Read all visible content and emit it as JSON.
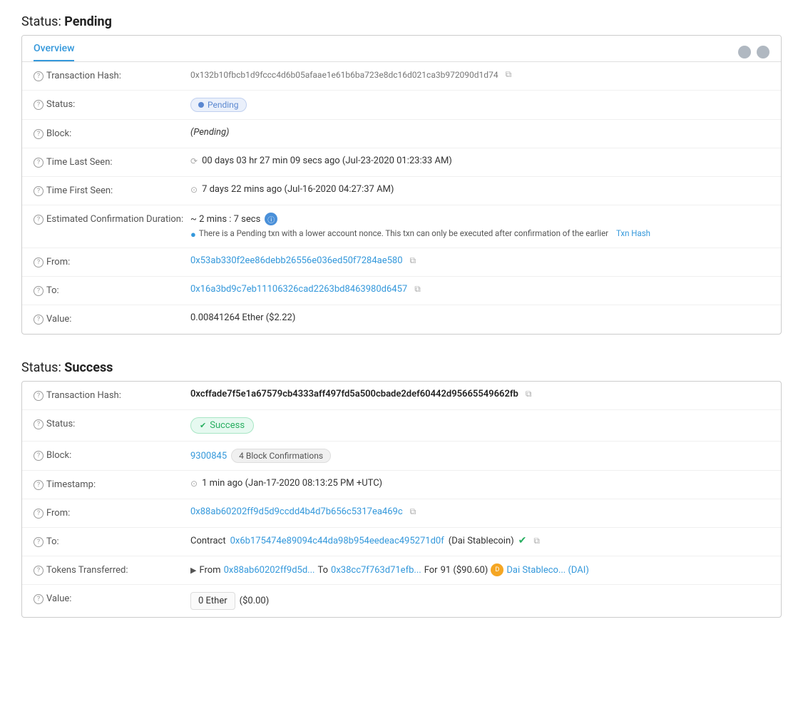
{
  "pending": {
    "section_title": "Status: ",
    "section_title_bold": "Pending",
    "tab_label": "Overview",
    "tx_hash_label": "Transaction Hash:",
    "tx_hash_value": "0x132b10fbcb1d9fccc4d6b05afaae1e61b6ba723e8dc16d021ca3b972090d1d74",
    "status_label": "Status:",
    "status_value": "Pending",
    "block_label": "Block:",
    "block_value": "(Pending)",
    "time_last_seen_label": "Time Last Seen:",
    "time_last_seen_value": "00 days 03 hr 27 min 09 secs ago (Jul-23-2020 01:23:33 AM)",
    "time_first_seen_label": "Time First Seen:",
    "time_first_seen_value": "7 days 22 mins ago (Jul-16-2020 04:27:37 AM)",
    "est_confirmation_label": "Estimated Confirmation Duration:",
    "est_confirmation_value": "~ 2 mins : 7 secs",
    "warning_text": "There is a Pending txn with a lower account nonce. This txn can only be executed after confirmation of the earlier",
    "warning_link": "Txn Hash",
    "from_label": "From:",
    "from_value": "0x53ab330f2ee86debb26556e036ed50f7284ae580",
    "to_label": "To:",
    "to_value": "0x16a3bd9c7eb11106326cad2263bd8463980d6457",
    "value_label": "Value:",
    "value_eth": "0.00841264 Ether ($2.22)"
  },
  "success": {
    "section_title": "Status: ",
    "section_title_bold": "Success",
    "tx_hash_label": "Transaction Hash:",
    "tx_hash_value": "0xcffade7f5e1a67579cb4333aff497fd5a500cbade2def60442d95665549662fb",
    "status_label": "Status:",
    "status_value": "Success",
    "block_label": "Block:",
    "block_number": "9300845",
    "block_confirmations": "4 Block Confirmations",
    "timestamp_label": "Timestamp:",
    "timestamp_value": "1 min ago (Jan-17-2020 08:13:25 PM +UTC)",
    "from_label": "From:",
    "from_value": "0x88ab60202ff9d5d9ccdd4b4d7b656c5317ea469c",
    "to_label": "To:",
    "to_prefix": "Contract",
    "to_contract": "0x6b175474e89094c44da98b954eedeac495271d0f",
    "to_contract_name": "(Dai Stablecoin)",
    "tokens_transferred_label": "Tokens Transferred:",
    "tokens_from_prefix": "From",
    "tokens_from": "0x88ab60202ff9d5d...",
    "tokens_to_prefix": "To",
    "tokens_to": "0x38cc7f763d71efb...",
    "tokens_for_prefix": "For",
    "tokens_amount": "91 ($90.60)",
    "tokens_name": "Dai Stableco... (DAI)",
    "value_label": "Value:",
    "value_eth": "0 Ether",
    "value_usd": "($0.00)"
  }
}
